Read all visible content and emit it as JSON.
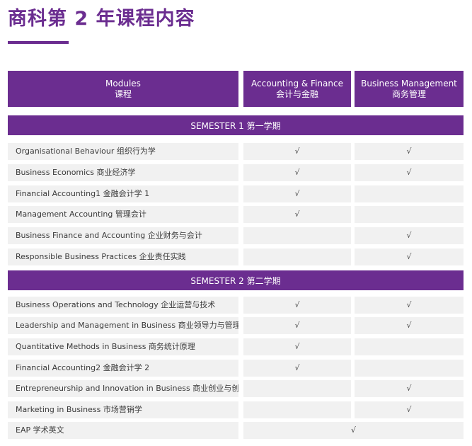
{
  "title": "商科第 2 年课程内容",
  "header": {
    "col1": {
      "en": "Modules",
      "zh": "课程"
    },
    "col2": {
      "en": "Accounting & Finance",
      "zh": "会计与金融"
    },
    "col3": {
      "en": "Business Management",
      "zh": "商务管理"
    }
  },
  "semesters": [
    {
      "label": "SEMESTER 1 第一学期",
      "rows": [
        {
          "module": "Organisational Behaviour 组织行为学",
          "af": "√",
          "bm": "√"
        },
        {
          "module": "Business Economics 商业经济学",
          "af": "√",
          "bm": "√"
        },
        {
          "module": "Financial Accounting1 金融会计学 1",
          "af": "√",
          "bm": ""
        },
        {
          "module": "Management Accounting 管理会计",
          "af": "√",
          "bm": ""
        },
        {
          "module": "Business Finance and Accounting 企业财务与会计",
          "af": "",
          "bm": "√"
        },
        {
          "module": "Responsible Business Practices 企业责任实践",
          "af": "",
          "bm": "√"
        }
      ]
    },
    {
      "label": "SEMESTER 2 第二学期",
      "rows": [
        {
          "module": "Business Operations and Technology 企业运营与技术",
          "af": "√",
          "bm": "√"
        },
        {
          "module": "Leadership and Management in Business 商业领导力与管理",
          "af": "√",
          "bm": "√"
        },
        {
          "module": "Quantitative Methods in Business 商务统计原理",
          "af": "√",
          "bm": ""
        },
        {
          "module": "Financial Accounting2 金融会计学 2",
          "af": "√",
          "bm": ""
        },
        {
          "module": "Entrepreneurship and Innovation in Business 商业创业与创新",
          "af": "",
          "bm": "√"
        },
        {
          "module": "Marketing in Business 市场营销学",
          "af": "",
          "bm": "√"
        }
      ]
    }
  ],
  "eap": {
    "module": "EAP 学术英文",
    "both": "√"
  }
}
